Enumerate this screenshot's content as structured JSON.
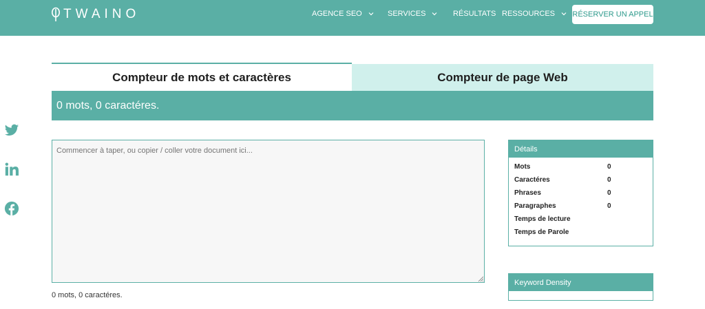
{
  "header": {
    "logo_text": "TWAINO",
    "nav": [
      {
        "label": "AGENCE SEO",
        "has_dropdown": true
      },
      {
        "label": "SERVICES",
        "has_dropdown": true
      },
      {
        "label": "RÉSULTATS",
        "has_dropdown": false
      },
      {
        "label": "RESSOURCES",
        "has_dropdown": true
      }
    ],
    "cta_label": "RÉSERVER UN APPEL"
  },
  "tabs": [
    {
      "label": "Compteur de mots et caractères",
      "active": true
    },
    {
      "label": "Compteur de page Web",
      "active": false
    }
  ],
  "summary": "0 mots, 0 caractéres.",
  "social": [
    "twitter-icon",
    "linkedin-icon",
    "facebook-icon"
  ],
  "editor": {
    "placeholder": "Commencer à taper, ou copier / coller votre document ici...",
    "count_text": "0 mots, 0 caractéres."
  },
  "details": {
    "title": "Détails",
    "rows": [
      {
        "label": "Mots",
        "value": "0"
      },
      {
        "label": "Caractéres",
        "value": "0"
      },
      {
        "label": "Phrases",
        "value": "0"
      },
      {
        "label": "Paragraphes",
        "value": "0"
      },
      {
        "label": "Temps de lecture",
        "value": ""
      },
      {
        "label": "Temps de Parole",
        "value": ""
      }
    ]
  },
  "keyword_density": {
    "title": "Keyword Density"
  },
  "colors": {
    "brand": "#5aafa5",
    "tab_inactive": "#d0f0ec",
    "editor_bg": "#f7f7f7"
  }
}
